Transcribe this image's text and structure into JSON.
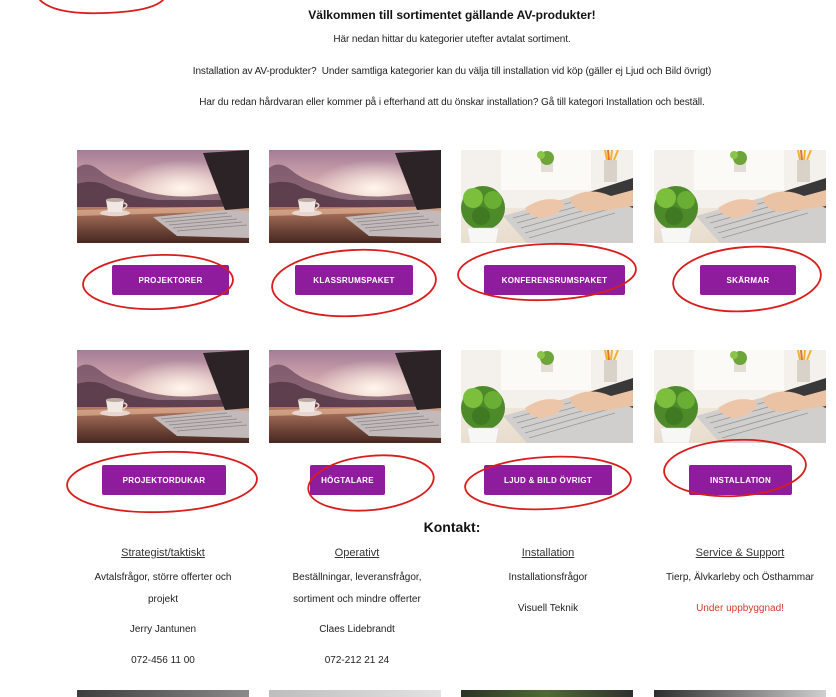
{
  "intro": {
    "title": "Välkommen till sortimentet gällande AV-produkter!",
    "subtitle": "Här nedan hittar du kategorier utefter avtalat sortiment.",
    "installation_note": "Installation av AV-produkter?  Under samtliga kategorier kan du välja till installation vid köp (gäller ej Ljud och Bild övrigt)",
    "hardware_note": "Har du redan hårdvaran eller kommer på i efterhand att du önskar installation? Gå till kategori Installation och beställ."
  },
  "categories": [
    {
      "label": "PROJEKTORER",
      "image": "laptop-sunset-photo"
    },
    {
      "label": "KLASSRUMSPAKET",
      "image": "laptop-sunset-photo"
    },
    {
      "label": "KONFERENSRUMSPAKET",
      "image": "typing-laptop-plant-photo"
    },
    {
      "label": "SKÄRMAR",
      "image": "typing-laptop-plant-photo"
    },
    {
      "label": "PROJEKTORDUKAR",
      "image": "laptop-sunset-photo"
    },
    {
      "label": "HÖGTALARE",
      "image": "laptop-sunset-photo"
    },
    {
      "label": "LJUD & BILD ÖVRIGT",
      "image": "typing-laptop-plant-photo"
    },
    {
      "label": "INSTALLATION",
      "image": "typing-laptop-plant-photo"
    }
  ],
  "contact": {
    "title": "Kontakt:",
    "columns": [
      {
        "heading": "Strategist/taktiskt",
        "lines": [
          "Avtalsfrågor, större offerter och",
          "projekt",
          "Jerry Jantunen",
          "072-456 11 00"
        ]
      },
      {
        "heading": "Operativt",
        "lines": [
          "Beställningar, leveransfrågor,",
          "sortiment och mindre offerter",
          "Claes Lidebrandt",
          "072-212 21 24"
        ]
      },
      {
        "heading": "Installation",
        "lines": [
          "Installationsfrågor",
          "Visuell Teknik"
        ]
      },
      {
        "heading": "Service & Support",
        "lines": [
          "Tierp, Älvkarleby och Östhammar",
          "Under uppbyggnad!"
        ]
      }
    ]
  },
  "colors": {
    "button_bg": "#8e1c9c",
    "button_text": "#ffffff",
    "body_text": "#222222",
    "notice_text": "#d23a2e",
    "annotation": "#d91c1c"
  }
}
